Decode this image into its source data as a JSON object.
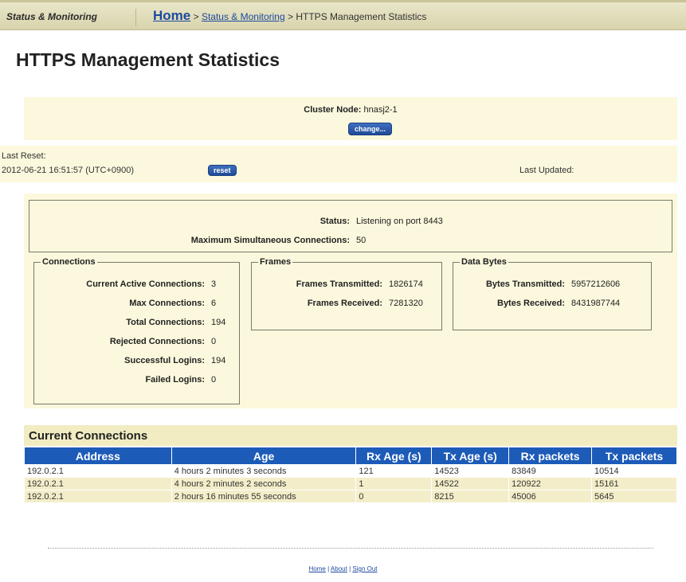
{
  "topbar": {
    "section": "Status & Monitoring",
    "breadcrumb": {
      "home": "Home",
      "sep1": ">",
      "status": "Status & Monitoring",
      "sep2": ">",
      "current": "HTTPS Management Statistics"
    }
  },
  "page_title": "HTTPS Management Statistics",
  "node": {
    "label": "Cluster Node:",
    "value": "hnasj2-1",
    "change_button": "change..."
  },
  "reset": {
    "label": "Last Reset:",
    "value": "2012-06-21 16:51:57 (UTC+0900)",
    "reset_button": "reset",
    "last_updated_label": "Last Updated:"
  },
  "status": {
    "status_label": "Status:",
    "status_value": "Listening on port 8443",
    "max_label": "Maximum Simultaneous Connections:",
    "max_value": "50"
  },
  "connections": {
    "legend": "Connections",
    "rows": [
      {
        "label": "Current Active Connections:",
        "value": "3"
      },
      {
        "label": "Max Connections:",
        "value": "6"
      },
      {
        "label": "Total Connections:",
        "value": "194"
      },
      {
        "label": "Rejected Connections:",
        "value": "0"
      },
      {
        "label": "Successful Logins:",
        "value": "194"
      },
      {
        "label": "Failed Logins:",
        "value": "0"
      }
    ]
  },
  "frames": {
    "legend": "Frames",
    "rows": [
      {
        "label": "Frames Transmitted:",
        "value": "1826174"
      },
      {
        "label": "Frames Received:",
        "value": "7281320"
      }
    ]
  },
  "data_bytes": {
    "legend": "Data Bytes",
    "rows": [
      {
        "label": "Bytes Transmitted:",
        "value": "5957212606"
      },
      {
        "label": "Bytes Received:",
        "value": "8431987744"
      }
    ]
  },
  "current_connections": {
    "title": "Current Connections",
    "headers": [
      "Address",
      "Age",
      "Rx Age (s)",
      "Tx Age (s)",
      "Rx packets",
      "Tx packets"
    ],
    "rows": [
      [
        "192.0.2.1",
        "4 hours 2 minutes 3 seconds",
        "121",
        "14523",
        "83849",
        "10514"
      ],
      [
        "192.0.2.1",
        "4 hours 2 minutes 2 seconds",
        "1",
        "14522",
        "120922",
        "15161"
      ],
      [
        "192.0.2.1",
        "2 hours 16 minutes 55 seconds",
        "0",
        "8215",
        "45006",
        "5645"
      ]
    ]
  },
  "footer": {
    "home": "Home",
    "sep1": "|",
    "about": "About",
    "sep2": "|",
    "signout": "Sign Out"
  }
}
